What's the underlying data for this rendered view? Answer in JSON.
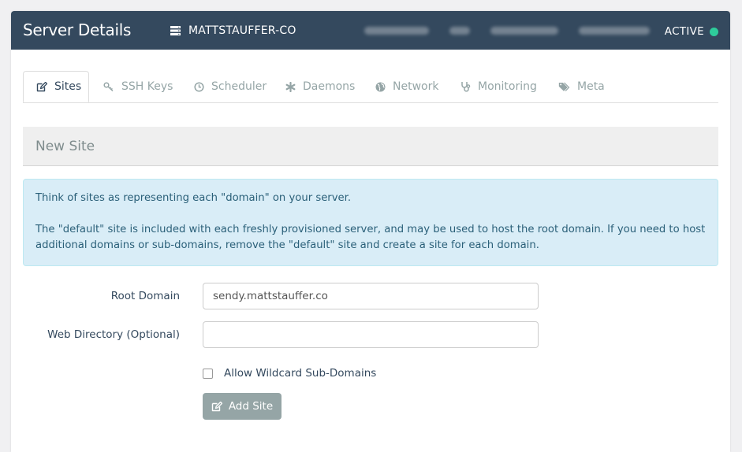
{
  "header": {
    "title": "Server Details",
    "server_name": "MATTSTAUFFER-CO",
    "status": "ACTIVE",
    "status_color": "#2ecc9b",
    "background": "#34495e"
  },
  "tabs": [
    {
      "label": "Sites",
      "icon": "edit-icon",
      "active": true
    },
    {
      "label": "SSH Keys",
      "icon": "key-icon",
      "active": false
    },
    {
      "label": "Scheduler",
      "icon": "clock-icon",
      "active": false
    },
    {
      "label": "Daemons",
      "icon": "asterisk-icon",
      "active": false
    },
    {
      "label": "Network",
      "icon": "globe-icon",
      "active": false
    },
    {
      "label": "Monitoring",
      "icon": "stethoscope-icon",
      "active": false
    },
    {
      "label": "Meta",
      "icon": "tags-icon",
      "active": false
    }
  ],
  "section": {
    "title": "New Site"
  },
  "info": {
    "line1": "Think of sites as representing each \"domain\" on your server.",
    "line2": "The \"default\" site is included with each freshly provisioned server, and may be used to host the root domain. If you need to host additional domains or sub-domains, remove the \"default\" site and create a site for each domain."
  },
  "form": {
    "root_domain_label": "Root Domain",
    "root_domain_value": "sendy.mattstauffer.co",
    "web_directory_label": "Web Directory (Optional)",
    "web_directory_value": "",
    "wildcard_label": "Allow Wildcard Sub-Domains",
    "wildcard_checked": false,
    "submit_label": "Add Site"
  }
}
